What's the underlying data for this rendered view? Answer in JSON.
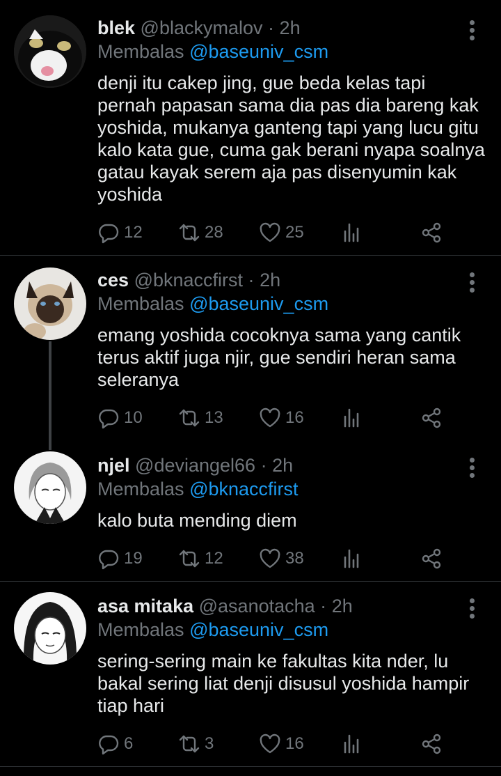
{
  "tweets": [
    {
      "name": "blek",
      "handle": "@blackymalov",
      "sep": "·",
      "time": "2h",
      "reply_prefix": "Membalas",
      "reply_to": "@baseuniv_csm",
      "text": "denji itu cakep jing, gue beda kelas tapi pernah papasan sama dia pas dia bareng kak yoshida, mukanya ganteng tapi yang lucu gitu kalo kata gue, cuma gak berani nyapa soalnya gatau kayak serem aja pas disenyumin kak yoshida",
      "replies": "12",
      "retweets": "28",
      "likes": "25",
      "avatar": "black-white-cat"
    },
    {
      "name": "ces",
      "handle": "@bknaccfirst",
      "sep": "·",
      "time": "2h",
      "reply_prefix": "Membalas",
      "reply_to": "@baseuniv_csm",
      "text": "emang yoshida cocoknya sama yang cantik terus aktif juga njir, gue sendiri heran sama seleranya",
      "replies": "10",
      "retweets": "13",
      "likes": "16",
      "avatar": "siamese-cat"
    },
    {
      "name": "njel",
      "handle": "@deviangel66",
      "sep": "·",
      "time": "2h",
      "reply_prefix": "Membalas",
      "reply_to": "@bknaccfirst",
      "text": "kalo buta mending diem",
      "replies": "19",
      "retweets": "12",
      "likes": "38",
      "avatar": "manga-character-angel"
    },
    {
      "name": "asa mitaka",
      "handle": "@asanotacha",
      "sep": "·",
      "time": "2h",
      "reply_prefix": "Membalas",
      "reply_to": "@baseuniv_csm",
      "text": "sering-sering main ke fakultas kita nder, lu bakal sering liat denji disusul yoshida hampir tiap hari",
      "replies": "6",
      "retweets": "3",
      "likes": "16",
      "avatar": "manga-character-asa"
    }
  ],
  "colors": {
    "background": "#000000",
    "text": "#e7e9ea",
    "muted": "#71767b",
    "mention": "#1d9bf0",
    "divider": "#2f3336"
  },
  "icons": [
    "reply-icon",
    "retweet-icon",
    "like-icon",
    "views-icon",
    "share-icon",
    "more-icon"
  ]
}
